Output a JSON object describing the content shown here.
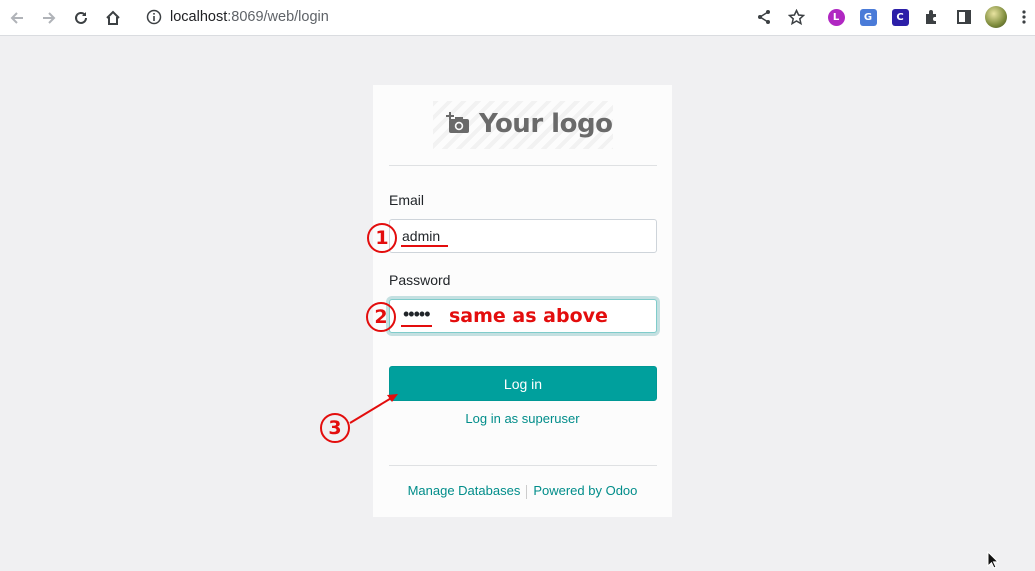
{
  "browser": {
    "url_host": "localhost",
    "url_rest": ":8069/web/login",
    "icons": [
      "back-icon",
      "forward-icon",
      "reload-icon",
      "home-icon",
      "site-info-icon",
      "share-icon",
      "bookmark-star-icon",
      "extension-lt-icon",
      "extension-translate-icon",
      "extension-c-icon",
      "extensions-puzzle-icon",
      "side-panel-icon",
      "profile-avatar",
      "menu-icon"
    ]
  },
  "login": {
    "logo_text": "Your logo",
    "email_label": "Email",
    "email_value": "admin",
    "password_label": "Password",
    "password_dots": "•••••",
    "login_button": "Log in",
    "superuser_link": "Log in as superuser",
    "manage_databases": "Manage Databases",
    "powered_by": "Powered by Odoo"
  },
  "annotations": {
    "step1": "1",
    "step2": "2",
    "step3": "3",
    "note": "same as above"
  },
  "colors": {
    "accent": "#00a09d",
    "link": "#018d8a",
    "annotation": "#e30d0d"
  }
}
